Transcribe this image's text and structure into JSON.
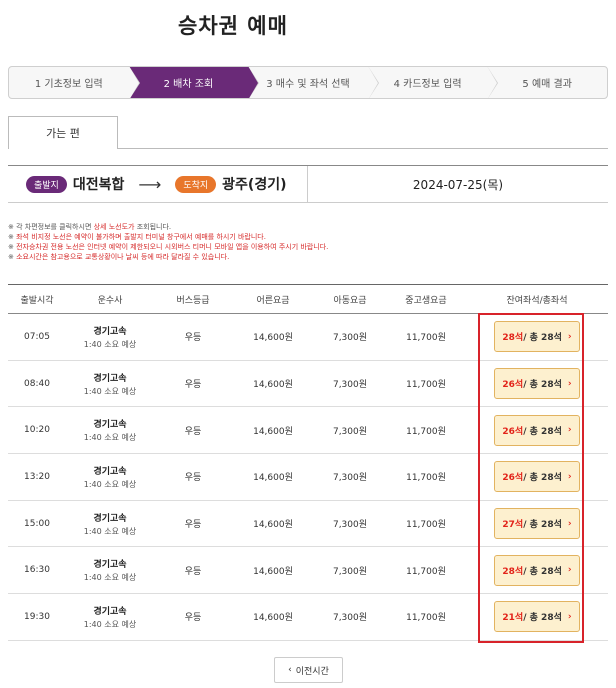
{
  "title": "승차권 예매",
  "steps": [
    {
      "label": "1 기초정보 입력",
      "active": false
    },
    {
      "label": "2 배차 조회",
      "active": true
    },
    {
      "label": "3 매수 및 좌석 선택",
      "active": false
    },
    {
      "label": "4 카드정보 입력",
      "active": false
    },
    {
      "label": "5 예매 결과",
      "active": false
    }
  ],
  "tab": {
    "label": "가는 편"
  },
  "route": {
    "departure_badge": "출발지",
    "departure": "대전복합",
    "arrow": "⟶",
    "arrival_badge": "도착지",
    "arrival": "광주(경기)",
    "date": "2024-07-25(목)"
  },
  "notes": [
    {
      "prefix": "※ 각 차편정보를 클릭하시면 ",
      "red": "상세 노선도가",
      "suffix": " 조회됩니다."
    },
    {
      "prefix": "※ ",
      "red": "좌석 비지정 노선은 예약이 불가하며 출발지 터미널 창구에서 예매를 하시기 바랍니다.",
      "suffix": ""
    },
    {
      "prefix": "※ ",
      "red": "전자승차권 전용 노선은 인터넷 예약이 제한되오니 시외버스 티머니 모바일 앱을 이용하여 주시기 바랍니다.",
      "suffix": ""
    },
    {
      "prefix": "※ ",
      "red": "소요시간은 참고용으로 교통상황이나 날씨 등에 따라 달라질 수 있습니다.",
      "suffix": ""
    }
  ],
  "table": {
    "headers": {
      "time": "출발시각",
      "company": "운수사",
      "grade": "버스등급",
      "adult": "어른요금",
      "child": "아동요금",
      "teen": "중고생요금",
      "seats": "잔여좌석/총좌석"
    },
    "rows": [
      {
        "time": "07:05",
        "company": "경기고속",
        "duration": "1:40 소요 예상",
        "grade": "우등",
        "adult": "14,600원",
        "child": "7,300원",
        "teen": "11,700원",
        "avail": "28석",
        "total": " / 총 28석"
      },
      {
        "time": "08:40",
        "company": "경기고속",
        "duration": "1:40 소요 예상",
        "grade": "우등",
        "adult": "14,600원",
        "child": "7,300원",
        "teen": "11,700원",
        "avail": "26석",
        "total": " / 총 28석"
      },
      {
        "time": "10:20",
        "company": "경기고속",
        "duration": "1:40 소요 예상",
        "grade": "우등",
        "adult": "14,600원",
        "child": "7,300원",
        "teen": "11,700원",
        "avail": "26석",
        "total": " / 총 28석"
      },
      {
        "time": "13:20",
        "company": "경기고속",
        "duration": "1:40 소요 예상",
        "grade": "우등",
        "adult": "14,600원",
        "child": "7,300원",
        "teen": "11,700원",
        "avail": "26석",
        "total": " / 총 28석"
      },
      {
        "time": "15:00",
        "company": "경기고속",
        "duration": "1:40 소요 예상",
        "grade": "우등",
        "adult": "14,600원",
        "child": "7,300원",
        "teen": "11,700원",
        "avail": "27석",
        "total": " / 총 28석"
      },
      {
        "time": "16:30",
        "company": "경기고속",
        "duration": "1:40 소요 예상",
        "grade": "우등",
        "adult": "14,600원",
        "child": "7,300원",
        "teen": "11,700원",
        "avail": "28석",
        "total": " / 총 28석"
      },
      {
        "time": "19:30",
        "company": "경기고속",
        "duration": "1:40 소요 예상",
        "grade": "우등",
        "adult": "14,600원",
        "child": "7,300원",
        "teen": "11,700원",
        "avail": "21석",
        "total": " / 총 28석"
      }
    ]
  },
  "prev_button": {
    "label": "이전시간",
    "icon": "chevron-left-icon"
  },
  "colors": {
    "accent": "#6a2a78",
    "arrival_badge": "#e8762b",
    "highlight": "#d8232a",
    "seat_button_bg": "#fdf0cf"
  }
}
